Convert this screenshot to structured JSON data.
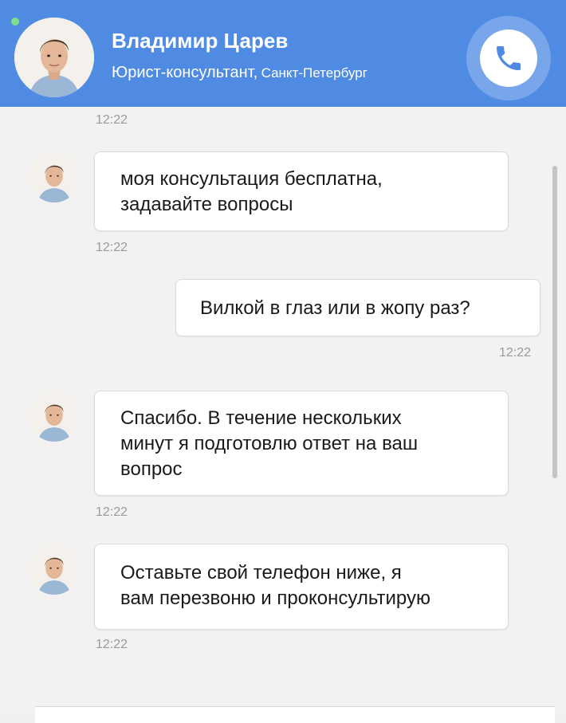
{
  "header": {
    "name": "Владимир Царев",
    "role": "Юрист-консультант",
    "separator": ",",
    "city": "Санкт-Петербург",
    "call_icon": "phone-icon",
    "online_indicator": "online-status-dot"
  },
  "colors": {
    "header_bg": "#4f8be3",
    "call_button_bg": "#79a6ea",
    "online": "#7fe08a",
    "chat_bg": "#f2f2f2",
    "bubble_bg": "#ffffff",
    "timestamp": "#9a9a9a"
  },
  "messages": [
    {
      "from": "consultant",
      "text": "",
      "time": "12:22"
    },
    {
      "from": "consultant",
      "text": "моя консультация бесплатна, задавайте вопросы",
      "line1": "моя консультация бесплатна,",
      "line2": "задавайте вопросы",
      "time": "12:22"
    },
    {
      "from": "user",
      "text": "Вилкой в глаз или в жопу раз?",
      "time": "12:22"
    },
    {
      "from": "consultant",
      "text": "Спасибо. В течение нескольких минут я подготовлю ответ на ваш вопрос",
      "line1": "Спасибо. В течение нескольких",
      "line2": "минут я подготовлю ответ на ваш",
      "line3": "вопрос",
      "time": "12:22"
    },
    {
      "from": "consultant",
      "text": "Оставьте свой телефон ниже, я вам перезвоню и проконсультирую",
      "line1": "Оставьте свой телефон ниже, я",
      "line2": "вам перезвоню и проконсультирую",
      "time": "12:22"
    }
  ]
}
